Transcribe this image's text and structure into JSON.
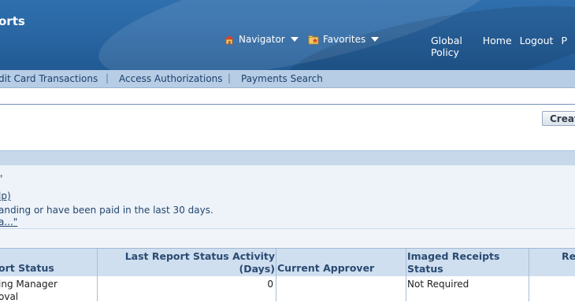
{
  "header": {
    "title": "orts",
    "navigator_label": "Navigator",
    "favorites_label": "Favorites",
    "global_links": [
      "Global Policy",
      "Home",
      "Logout",
      "P"
    ]
  },
  "tabs": [
    "dit Card Transactions",
    "Access Authorizations",
    "Payments Search"
  ],
  "actions": {
    "create_label": "Creat"
  },
  "info": {
    "line1": "\"",
    "line2": "lp)",
    "line3": "anding or have been paid in the last 30 days.",
    "line4": "a...\""
  },
  "table": {
    "headers": {
      "report_status": "ort Status",
      "last_activity_line1": "Last Report Status Activity",
      "last_activity_line2": "(Days)",
      "current_approver": "Current Approver",
      "imaged_line1": "Imaged Receipts",
      "imaged_line2": "Status",
      "re": "Re"
    },
    "rows": [
      {
        "status_line1": "ing Manager",
        "status_line2": "oval",
        "days": "0",
        "approver": "",
        "imaged": "Not Required"
      }
    ]
  },
  "colors": {
    "header_bg": "#2a67a4",
    "tabbar_bg": "#b6cde5",
    "table_header_bg": "#cfdff0"
  }
}
